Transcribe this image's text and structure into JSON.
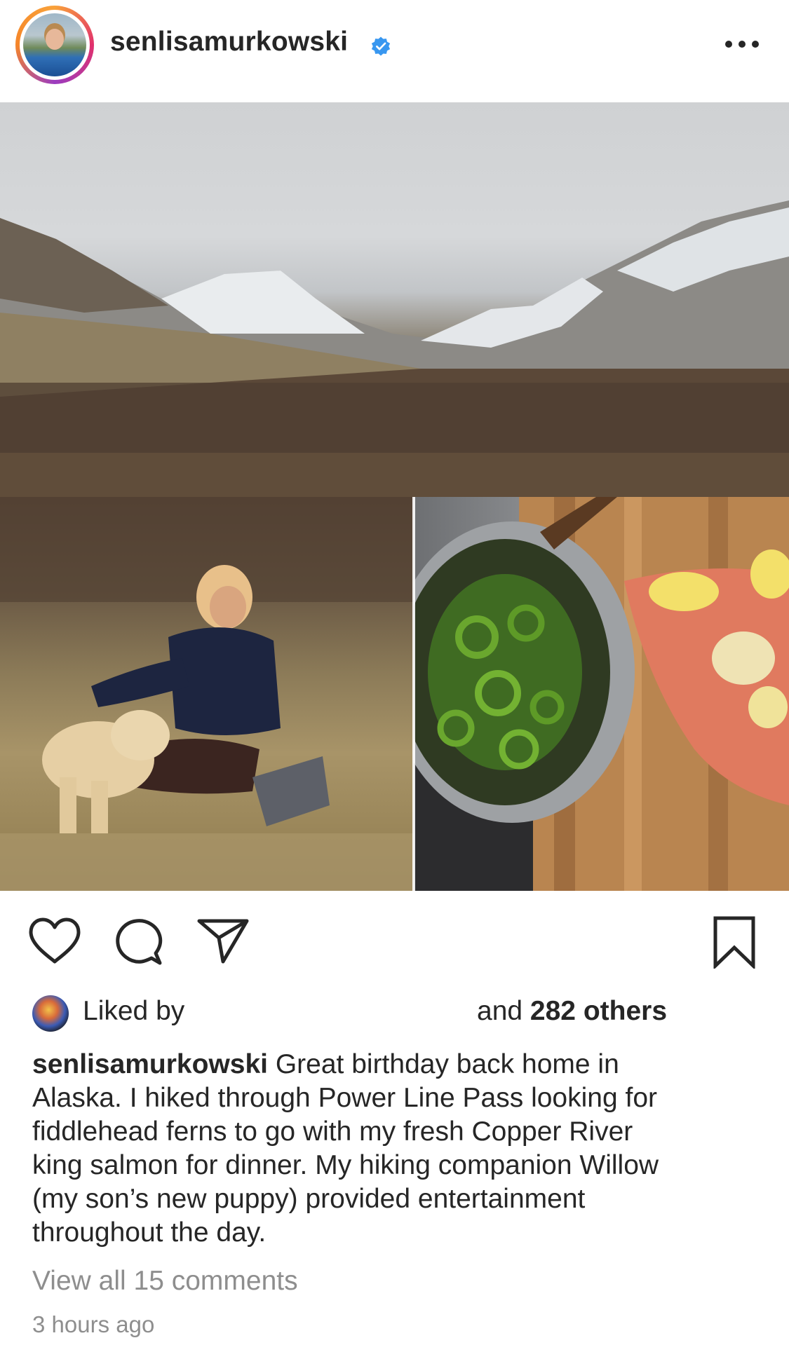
{
  "post": {
    "username": "senlisamurkowski",
    "verified_icon": "verified-badge-icon",
    "more_icon": "more-options-icon"
  },
  "actions": {
    "like_icon": "heart-icon",
    "comment_icon": "comment-icon",
    "share_icon": "paper-plane-icon",
    "save_icon": "bookmark-icon"
  },
  "likes": {
    "liked_by_text": "Liked by",
    "and_text": "and",
    "others_count": "282 others"
  },
  "caption": {
    "username": "senlisamurkowski",
    "lines": [
      "Great birthday back home in",
      "Alaska. I hiked through Power Line Pass looking for",
      "fiddlehead ferns to go with my fresh Copper River",
      "king salmon for dinner. My hiking companion Willow",
      "(my son’s new puppy) provided entertainment",
      "throughout the day."
    ]
  },
  "comments": {
    "view_all": "View all 15 comments"
  },
  "timestamp": "3 hours ago",
  "colors": {
    "text": "#262626",
    "muted": "#8e8e8e",
    "verified_blue": "#3897f0"
  }
}
